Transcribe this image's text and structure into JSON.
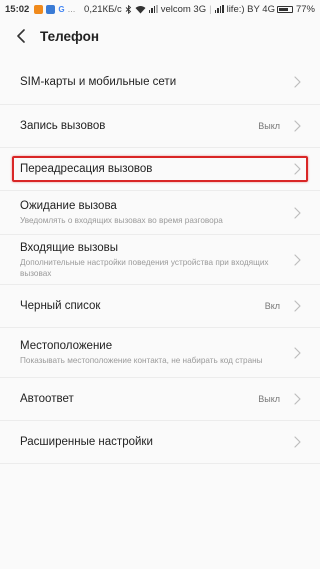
{
  "status_bar": {
    "time": "15:02",
    "network_speed": "0,21КБ/с",
    "carrier1": "velcom 3G",
    "carrier2": "life:) BY 4G",
    "battery": "77%",
    "battery_level": 0.77,
    "notif_icon_1_color": "#f08a1c",
    "notif_icon_2_color": "#3a7bd5",
    "notif_icon_3_label": "G"
  },
  "header": {
    "title": "Телефон",
    "back_icon": "chevron-left-icon"
  },
  "items": [
    {
      "label": "SIM-карты и мобильные сети",
      "sub": "",
      "value": ""
    },
    {
      "label": "Запись вызовов",
      "sub": "",
      "value": "Выкл"
    },
    {
      "label": "Переадресация вызовов",
      "sub": "",
      "value": "",
      "highlighted": true
    },
    {
      "label": "Ожидание вызова",
      "sub": "Уведомлять о входящих вызовах во время разговора",
      "value": ""
    },
    {
      "label": "Входящие вызовы",
      "sub": "Дополнительные настройки поведения устройства при входящих вызовах",
      "value": ""
    },
    {
      "label": "Черный список",
      "sub": "",
      "value": "Вкл"
    },
    {
      "label": "Местоположение",
      "sub": "Показывать местоположение контакта, не набирать код страны",
      "value": ""
    },
    {
      "label": "Автоответ",
      "sub": "",
      "value": "Выкл"
    },
    {
      "label": "Расширенные настройки",
      "sub": "",
      "value": ""
    }
  ],
  "colors": {
    "highlight": "#d92626",
    "background": "#fafafa"
  }
}
